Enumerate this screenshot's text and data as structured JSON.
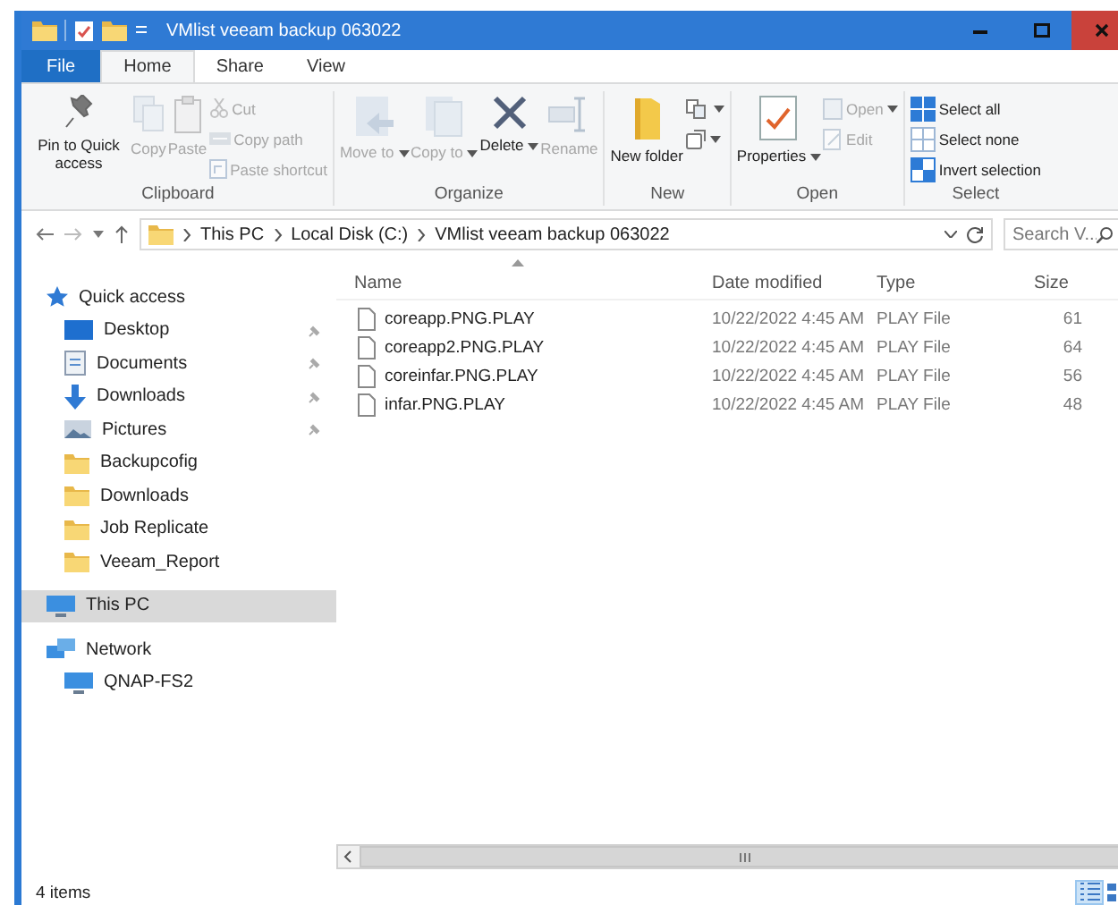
{
  "window": {
    "title": "VMlist veeam backup 063022"
  },
  "ribbon_tabs": [
    {
      "label": "File",
      "kind": "file",
      "selected": false
    },
    {
      "label": "Home",
      "kind": "tab",
      "selected": true
    },
    {
      "label": "Share",
      "kind": "tab",
      "selected": false
    },
    {
      "label": "View",
      "kind": "tab",
      "selected": false
    }
  ],
  "ribbon_groups": [
    {
      "label": "Clipboard",
      "commands": [
        {
          "label": "Pin to Quick access",
          "kind": "large",
          "disabled": false,
          "menu": false
        },
        {
          "label": "Copy",
          "kind": "large",
          "disabled": true,
          "menu": false
        },
        {
          "label": "Paste",
          "kind": "large",
          "disabled": true,
          "menu": false
        },
        {
          "label": "Cut",
          "kind": "small",
          "disabled": true,
          "menu": false
        },
        {
          "label": "Copy path",
          "kind": "small",
          "disabled": true,
          "menu": false
        },
        {
          "label": "Paste shortcut",
          "kind": "small",
          "disabled": true,
          "menu": false
        }
      ]
    },
    {
      "label": "Organize",
      "commands": [
        {
          "label": "Move to",
          "kind": "large",
          "disabled": true,
          "menu": true
        },
        {
          "label": "Copy to",
          "kind": "large",
          "disabled": true,
          "menu": true
        },
        {
          "label": "Delete",
          "kind": "large",
          "disabled": false,
          "menu": true
        },
        {
          "label": "Rename",
          "kind": "large",
          "disabled": true,
          "menu": false
        }
      ]
    },
    {
      "label": "New",
      "commands": [
        {
          "label": "New folder",
          "kind": "large",
          "disabled": false,
          "menu": false
        },
        {
          "kind": "icon",
          "disabled": false,
          "menu": true
        },
        {
          "kind": "icon",
          "disabled": false,
          "menu": true
        }
      ]
    },
    {
      "label": "Open",
      "commands": [
        {
          "label": "Properties",
          "kind": "large",
          "disabled": false,
          "menu": true
        },
        {
          "label": "Open",
          "kind": "small",
          "disabled": true,
          "menu": true
        },
        {
          "label": "Edit",
          "kind": "small",
          "disabled": true,
          "menu": false
        }
      ]
    },
    {
      "label": "Select",
      "commands": [
        {
          "label": "Select all",
          "kind": "small",
          "disabled": false,
          "menu": false
        },
        {
          "label": "Select none",
          "kind": "small",
          "disabled": false,
          "menu": false
        },
        {
          "label": "Invert selection",
          "kind": "small",
          "disabled": false,
          "menu": false
        }
      ]
    }
  ],
  "address": {
    "crumbs": [
      "This PC",
      "Local Disk (C:)",
      "VMlist veeam backup 063022"
    ],
    "search_placeholder": "Search V..."
  },
  "nav": [
    {
      "label": "Quick access",
      "kind": "star",
      "selected": false,
      "children": [
        {
          "label": "Desktop",
          "kind": "desktop",
          "selected": false,
          "pinned": true
        },
        {
          "label": "Documents",
          "kind": "documents",
          "selected": false,
          "pinned": true
        },
        {
          "label": "Downloads",
          "kind": "downloads",
          "selected": false,
          "pinned": true
        },
        {
          "label": "Pictures",
          "kind": "pictures",
          "selected": false,
          "pinned": true
        },
        {
          "label": "Backupcofig",
          "kind": "folder",
          "selected": false,
          "pinned": false
        },
        {
          "label": "Downloads",
          "kind": "folder",
          "selected": false,
          "pinned": false
        },
        {
          "label": "Job Replicate",
          "kind": "folder",
          "selected": false,
          "pinned": false
        },
        {
          "label": "Veeam_Report",
          "kind": "folder",
          "selected": false,
          "pinned": false
        }
      ]
    },
    {
      "label": "This PC",
      "kind": "computer",
      "selected": true
    },
    {
      "label": "Network",
      "kind": "network",
      "selected": false,
      "children": [
        {
          "label": "QNAP-FS2",
          "kind": "computer",
          "selected": false
        }
      ]
    }
  ],
  "files": {
    "columns": [
      {
        "label": "Name",
        "sorted": true
      },
      {
        "label": "Date modified",
        "sorted": false
      },
      {
        "label": "Type",
        "sorted": false
      },
      {
        "label": "Size",
        "sorted": false
      }
    ],
    "rows": [
      {
        "name": "coreapp.PNG.PLAY",
        "date": "10/22/2022 4:45 AM",
        "type": "PLAY File",
        "size": "61"
      },
      {
        "name": "coreapp2.PNG.PLAY",
        "date": "10/22/2022 4:45 AM",
        "type": "PLAY File",
        "size": "64"
      },
      {
        "name": "coreinfar.PNG.PLAY",
        "date": "10/22/2022 4:45 AM",
        "type": "PLAY File",
        "size": "56"
      },
      {
        "name": "infar.PNG.PLAY",
        "date": "10/22/2022 4:45 AM",
        "type": "PLAY File",
        "size": "48"
      }
    ]
  },
  "status_bar": {
    "text": "4 items",
    "views": [
      {
        "kind": "details",
        "selected": true
      },
      {
        "kind": "tiles",
        "selected": false
      }
    ]
  }
}
